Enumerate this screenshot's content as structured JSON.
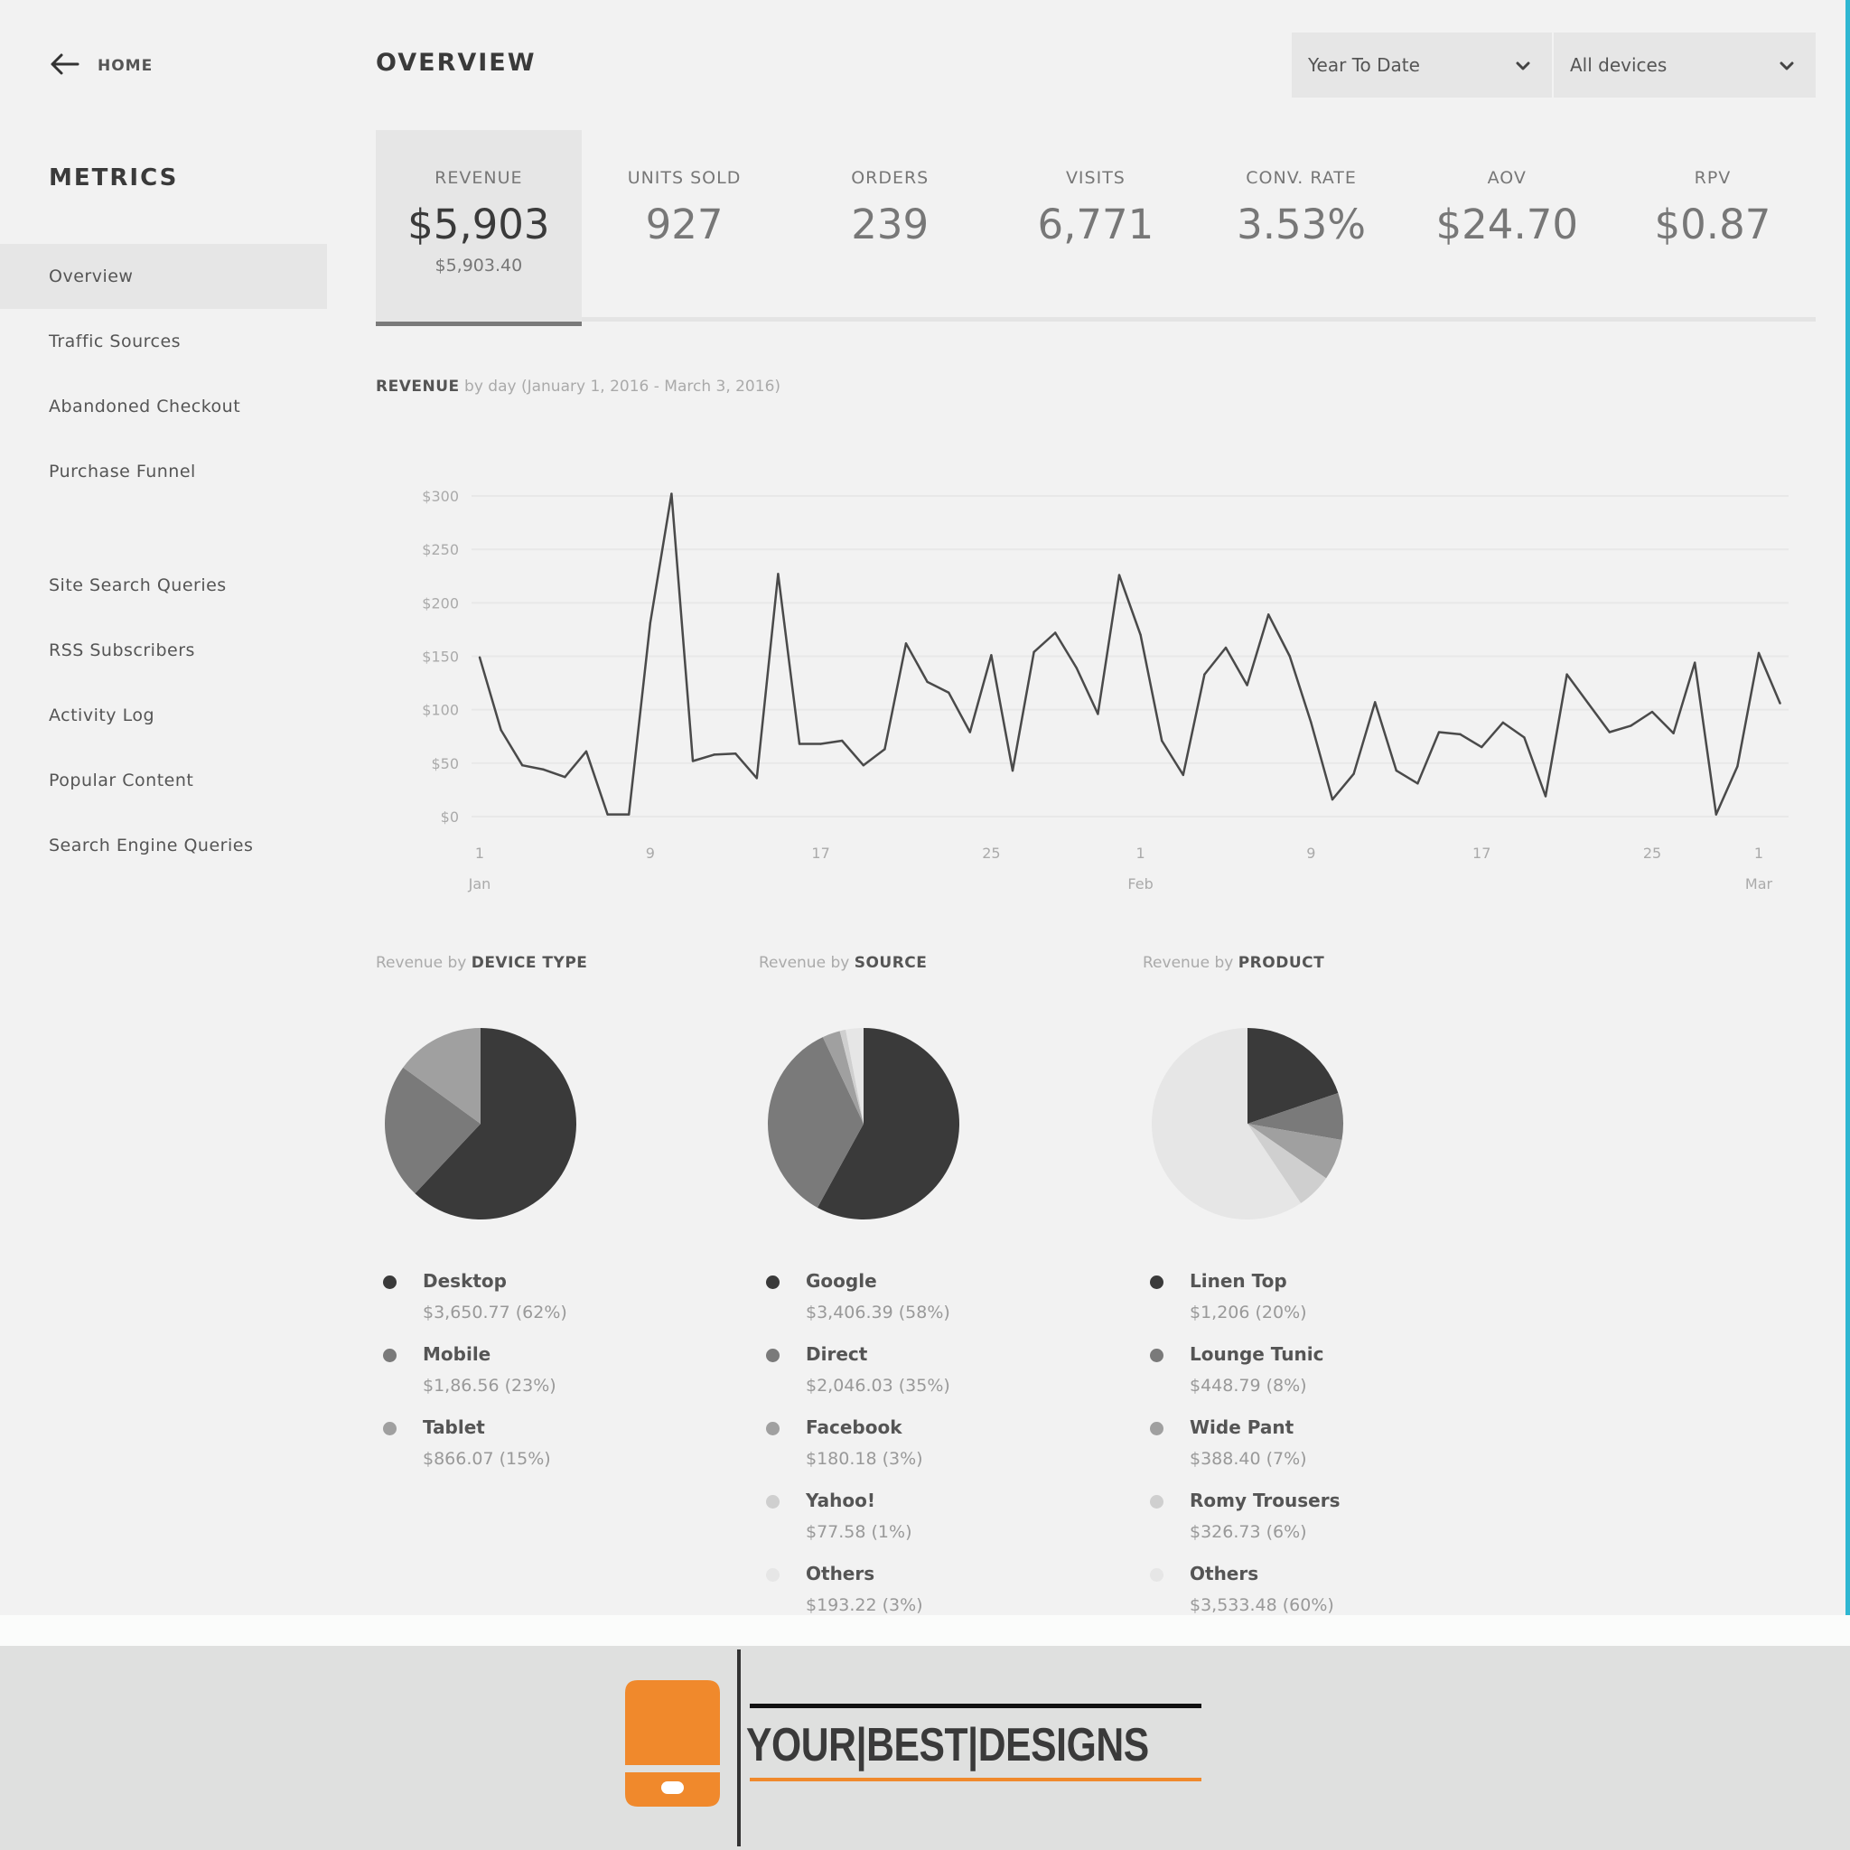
{
  "header": {
    "home_label": "HOME",
    "page_title": "OVERVIEW",
    "filters": [
      {
        "value": "Year To Date"
      },
      {
        "value": "All devices"
      }
    ]
  },
  "sidebar": {
    "heading": "METRICS",
    "groups": [
      [
        {
          "label": "Overview",
          "active": true
        },
        {
          "label": "Traffic Sources"
        },
        {
          "label": "Abandoned Checkout"
        },
        {
          "label": "Purchase Funnel"
        }
      ],
      [
        {
          "label": "Site Search Queries"
        },
        {
          "label": "RSS Subscribers"
        },
        {
          "label": "Activity Log"
        },
        {
          "label": "Popular Content"
        },
        {
          "label": "Search Engine Queries"
        }
      ]
    ]
  },
  "metrics": [
    {
      "label": "REVENUE",
      "value": "$5,903",
      "sub": "$5,903.40",
      "active": true
    },
    {
      "label": "UNITS SOLD",
      "value": "927"
    },
    {
      "label": "ORDERS",
      "value": "239"
    },
    {
      "label": "VISITS",
      "value": "6,771"
    },
    {
      "label": "CONV. RATE",
      "value": "3.53%"
    },
    {
      "label": "AOV",
      "value": "$24.70"
    },
    {
      "label": "RPV",
      "value": "$0.87"
    }
  ],
  "colors": {
    "accent_edge": "#2fb7d2",
    "line": "#4a4a4a",
    "logo_orange": "#f0892c"
  },
  "chart_data": [
    {
      "type": "line",
      "title_bold": "REVENUE",
      "title": "by day (January 1, 2016 - March 3, 2016)",
      "xlabel": "",
      "ylabel": "",
      "ylim": [
        0,
        300
      ],
      "yticks": [
        "$0",
        "$50",
        "$100",
        "$150",
        "$200",
        "$250",
        "$300"
      ],
      "ytick_values": [
        0,
        50,
        100,
        150,
        200,
        250,
        300
      ],
      "grid": true,
      "xticks": [
        {
          "day": 1,
          "label": "1",
          "month": "Jan"
        },
        {
          "day": 9,
          "label": "9"
        },
        {
          "day": 17,
          "label": "17"
        },
        {
          "day": 25,
          "label": "25"
        },
        {
          "day": 32,
          "label": "1",
          "month": "Feb"
        },
        {
          "day": 40,
          "label": "9"
        },
        {
          "day": 48,
          "label": "17"
        },
        {
          "day": 56,
          "label": "25"
        },
        {
          "day": 61,
          "label": "1",
          "month": "Mar"
        }
      ],
      "x_start_day": 1,
      "x_end_day": 62,
      "series": [
        {
          "name": "Revenue",
          "values": [
            149,
            81,
            48,
            44,
            37,
            61,
            2,
            2,
            181,
            302,
            52,
            58,
            59,
            36,
            227,
            68,
            68,
            71,
            48,
            63,
            162,
            126,
            116,
            79,
            151,
            43,
            154,
            172,
            139,
            96,
            226,
            170,
            71,
            39,
            133,
            158,
            123,
            189,
            150,
            88,
            16,
            40,
            107,
            43,
            31,
            79,
            77,
            65,
            88,
            74,
            19,
            133,
            106,
            79,
            85,
            98,
            78,
            144,
            2,
            47,
            153,
            106
          ]
        }
      ]
    },
    {
      "type": "pie",
      "title_prefix": "Revenue by",
      "title": "DEVICE TYPE",
      "slices": [
        {
          "label": "Desktop",
          "value": 3650.77,
          "percent": 62,
          "display": "$3,650.77 (62%)",
          "color": "#3a3a3a"
        },
        {
          "label": "Mobile",
          "value": 1386.56,
          "percent": 23,
          "display": "$1,86.56 (23%)",
          "color": "#7a7a7a"
        },
        {
          "label": "Tablet",
          "value": 866.07,
          "percent": 15,
          "display": "$866.07 (15%)",
          "color": "#a0a0a0"
        }
      ]
    },
    {
      "type": "pie",
      "title_prefix": "Revenue by",
      "title": "SOURCE",
      "slices": [
        {
          "label": "Google",
          "value": 3406.39,
          "percent": 58,
          "display": "$3,406.39 (58%)",
          "color": "#3a3a3a"
        },
        {
          "label": "Direct",
          "value": 2046.03,
          "percent": 35,
          "display": "$2,046.03 (35%)",
          "color": "#7a7a7a"
        },
        {
          "label": "Facebook",
          "value": 180.18,
          "percent": 3,
          "display": "$180.18 (3%)",
          "color": "#a0a0a0"
        },
        {
          "label": "Yahoo!",
          "value": 77.58,
          "percent": 1,
          "display": "$77.58 (1%)",
          "color": "#cfcfcf"
        },
        {
          "label": "Others",
          "value": 193.22,
          "percent": 3,
          "display": "$193.22 (3%)",
          "color": "#e6e6e6"
        }
      ]
    },
    {
      "type": "pie",
      "title_prefix": "Revenue by",
      "title": "PRODUCT",
      "slices": [
        {
          "label": "Linen Top",
          "value": 1206,
          "percent": 20,
          "display": "$1,206 (20%)",
          "color": "#3a3a3a"
        },
        {
          "label": "Lounge Tunic",
          "value": 448.79,
          "percent": 8,
          "display": "$448.79 (8%)",
          "color": "#7a7a7a"
        },
        {
          "label": "Wide Pant",
          "value": 388.4,
          "percent": 7,
          "display": "$388.40 (7%)",
          "color": "#a0a0a0"
        },
        {
          "label": "Romy Trousers",
          "value": 326.73,
          "percent": 6,
          "display": "$326.73 (6%)",
          "color": "#cfcfcf"
        },
        {
          "label": "Others",
          "value": 3533.48,
          "percent": 60,
          "display": "$3,533.48 (60%)",
          "color": "#e6e6e6"
        }
      ]
    }
  ],
  "footer": {
    "brand_parts": [
      "YOUR",
      "BEST",
      "DESIGNS"
    ]
  }
}
